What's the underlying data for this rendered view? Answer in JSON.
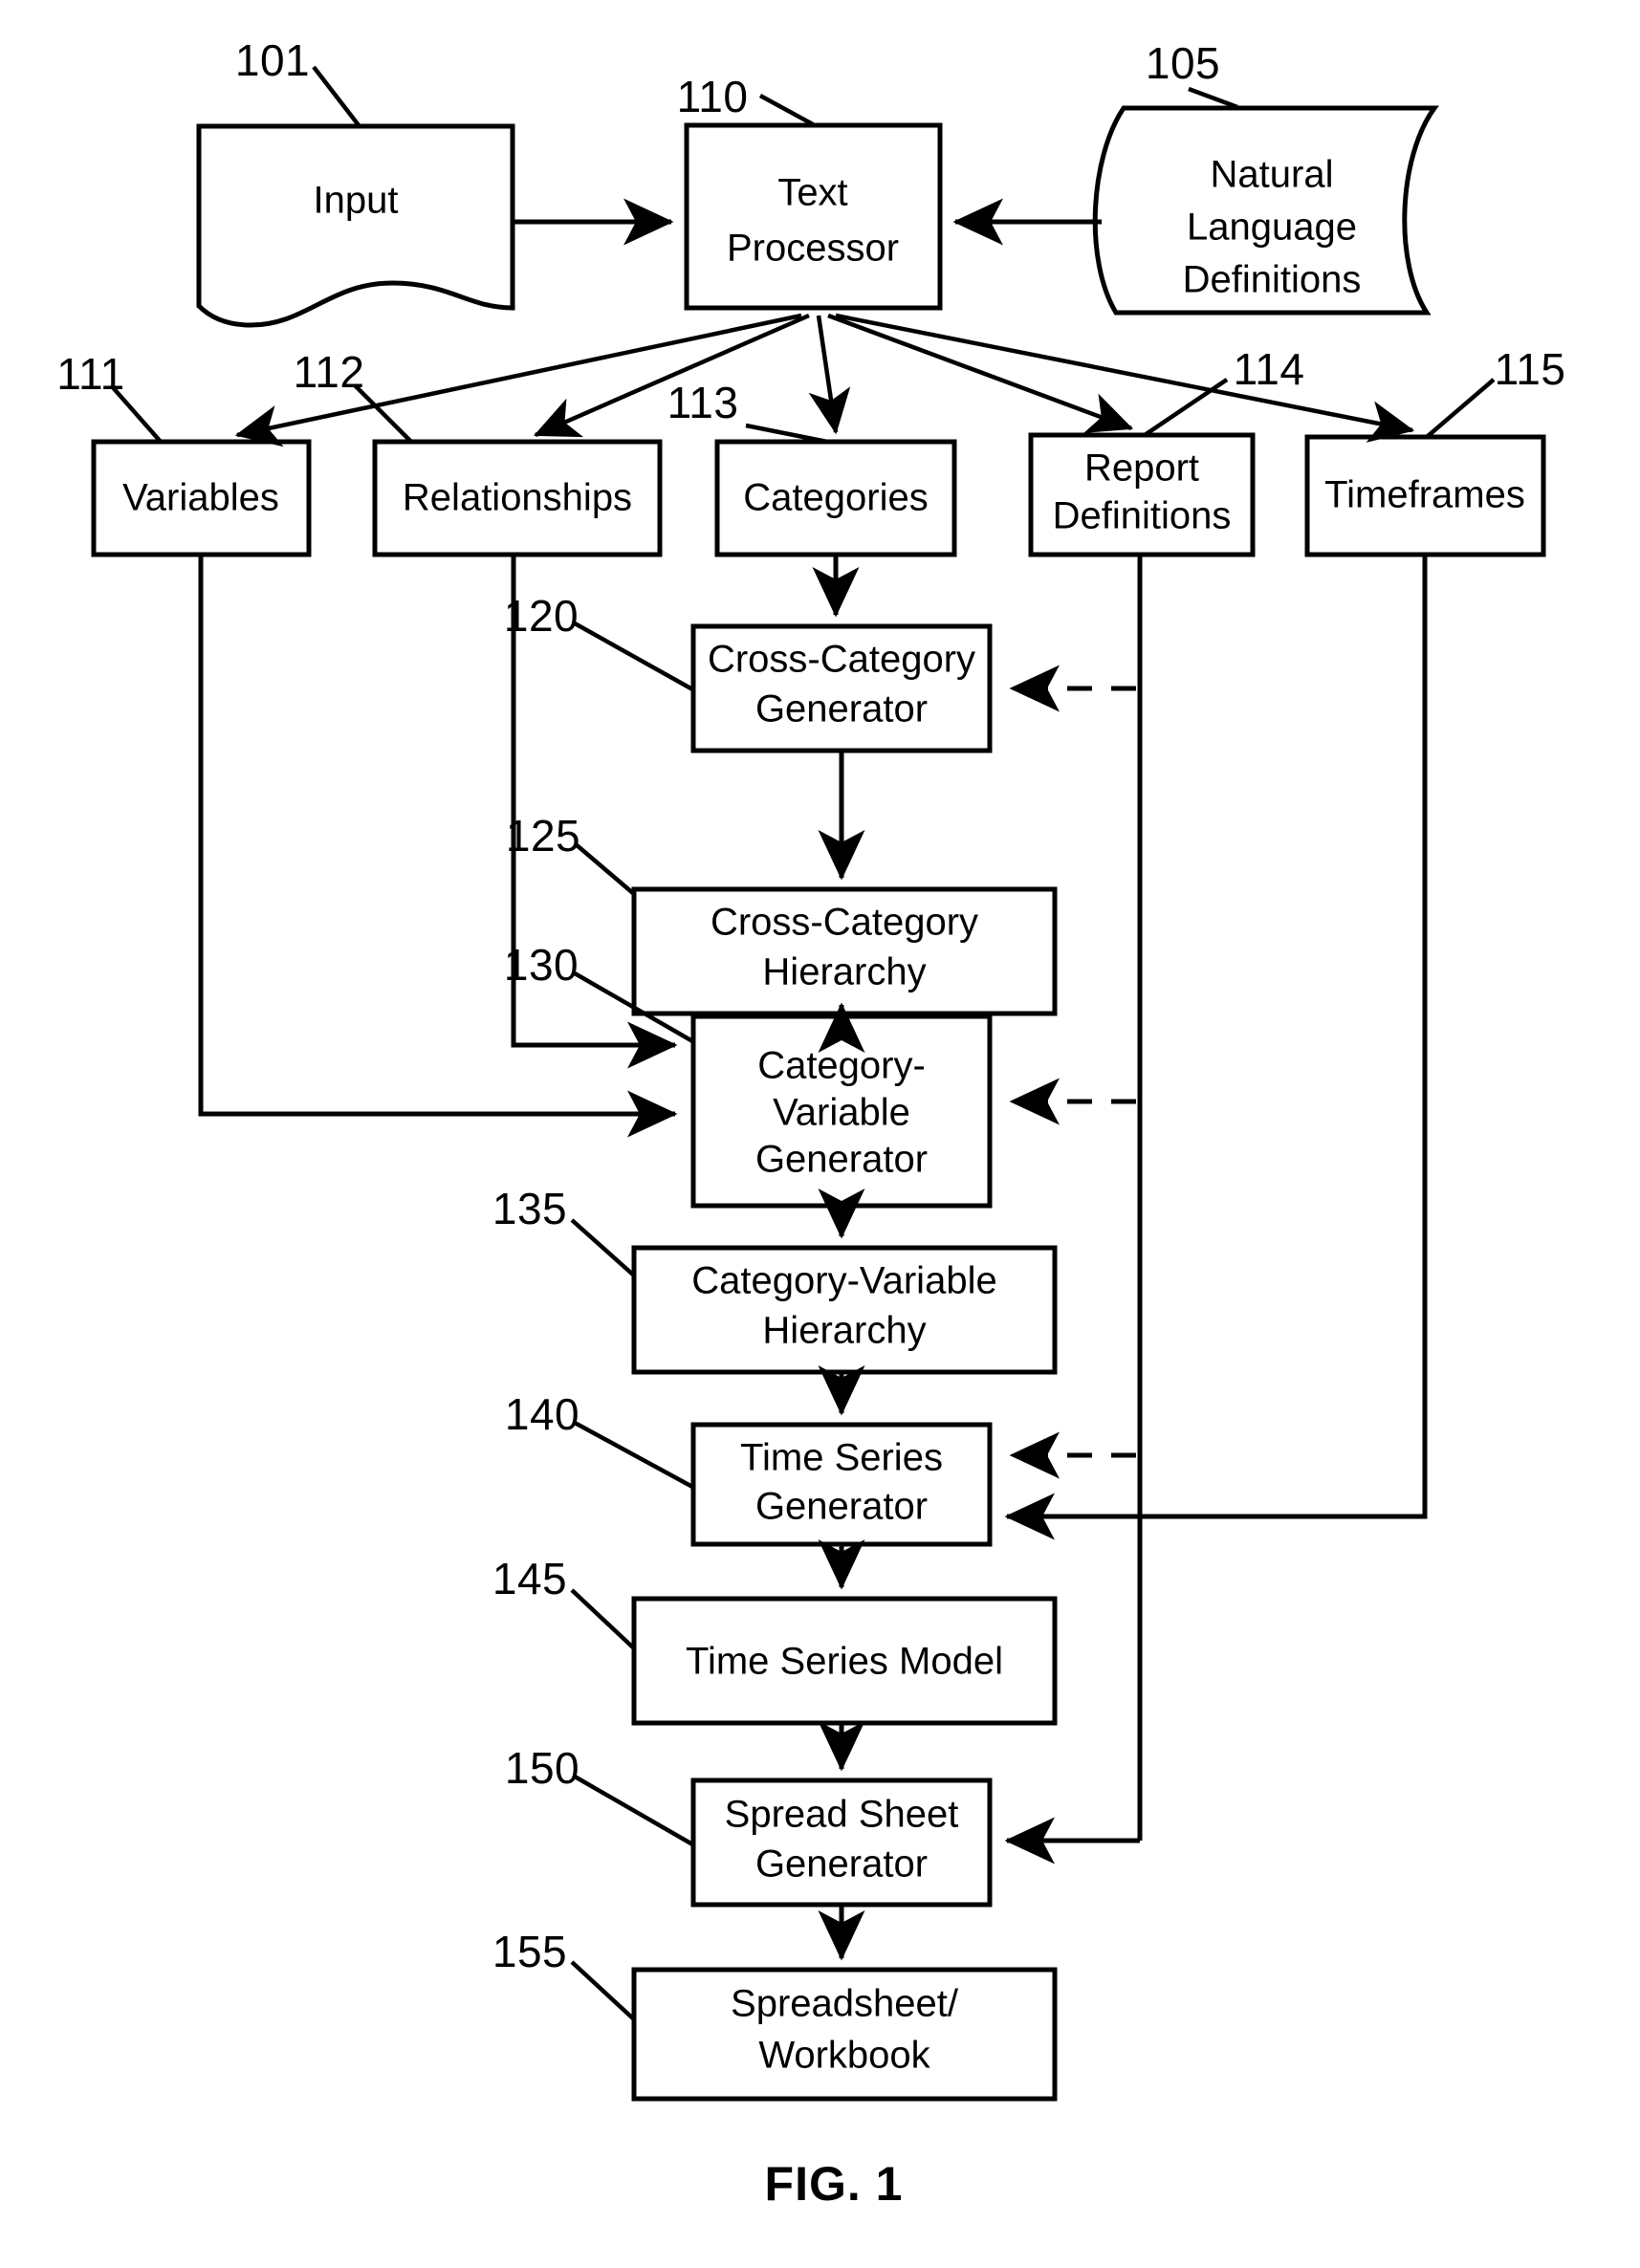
{
  "figure": {
    "caption": "FIG. 1",
    "title": "Text Processor to Spreadsheet Generation Flow Diagram"
  },
  "nodes": {
    "input": {
      "ref": "101",
      "label": "Input",
      "shape": "document"
    },
    "text_processor": {
      "ref": "110",
      "label_line1": "Text",
      "label_line2": "Processor",
      "shape": "rectangle"
    },
    "natural_language_definitions": {
      "ref": "105",
      "label_line1": "Natural",
      "label_line2": "Language",
      "label_line3": "Definitions",
      "shape": "stored-data"
    },
    "variables": {
      "ref": "111",
      "label": "Variables",
      "shape": "rectangle"
    },
    "relationships": {
      "ref": "112",
      "label": "Relationships",
      "shape": "rectangle"
    },
    "categories": {
      "ref": "113",
      "label": "Categories",
      "shape": "rectangle"
    },
    "report_definitions": {
      "ref": "114",
      "label_line1": "Report",
      "label_line2": "Definitions",
      "shape": "rectangle"
    },
    "timeframes": {
      "ref": "115",
      "label": "Timeframes",
      "shape": "rectangle"
    },
    "cross_category_generator": {
      "ref": "120",
      "label_line1": "Cross-Category",
      "label_line2": "Generator",
      "shape": "rectangle"
    },
    "cross_category_hierarchy": {
      "ref": "125",
      "label_line1": "Cross-Category",
      "label_line2": "Hierarchy",
      "shape": "rectangle"
    },
    "category_variable_generator": {
      "ref": "130",
      "label_line1": "Category-",
      "label_line2": "Variable",
      "label_line3": "Generator",
      "shape": "rectangle"
    },
    "category_variable_hierarchy": {
      "ref": "135",
      "label_line1": "Category-Variable",
      "label_line2": "Hierarchy",
      "shape": "rectangle"
    },
    "time_series_generator": {
      "ref": "140",
      "label_line1": "Time Series",
      "label_line2": "Generator",
      "shape": "rectangle"
    },
    "time_series_model": {
      "ref": "145",
      "label": "Time Series Model",
      "shape": "rectangle"
    },
    "spread_sheet_generator": {
      "ref": "150",
      "label_line1": "Spread Sheet",
      "label_line2": "Generator",
      "shape": "rectangle"
    },
    "spreadsheet_workbook": {
      "ref": "155",
      "label_line1": "Spreadsheet/",
      "label_line2": "Workbook",
      "shape": "rectangle"
    }
  },
  "style": {
    "line_color": "#000000",
    "fill_color": "#ffffff",
    "background": "#ffffff"
  }
}
